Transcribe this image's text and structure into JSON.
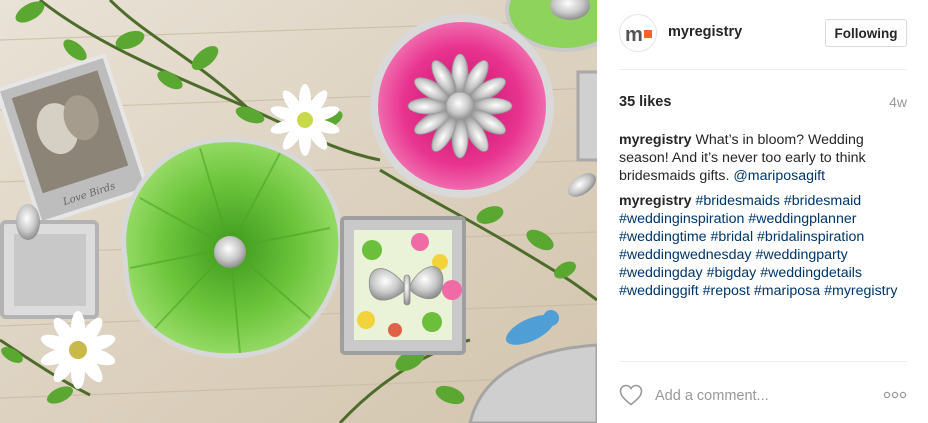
{
  "header": {
    "avatar_logo": "m",
    "username": "myregistry",
    "follow_label": "Following"
  },
  "stats": {
    "likes": "35 likes",
    "age": "4w"
  },
  "caption": {
    "author": "myregistry",
    "text": "What’s in bloom? Wedding season! And it’s never too early to think bridesmaids gifts.",
    "mention": "@mariposagift"
  },
  "hashtags_comment": {
    "author": "myregistry",
    "tags": [
      "#bridesmaids",
      "#bridesmaid",
      "#weddinginspiration",
      "#weddingplanner",
      "#weddingtime",
      "#bridal",
      "#bridalinspiration",
      "#weddingwednesday",
      "#weddingparty",
      "#weddingday",
      "#bigday",
      "#weddingdetails",
      "#weddinggift",
      "#repost",
      "#mariposa",
      "#myregistry"
    ]
  },
  "comment_box": {
    "placeholder": "Add a comment..."
  },
  "icons": {
    "like": "heart-outline-icon",
    "more": "more-options-icon"
  },
  "colors": {
    "link": "#003569",
    "muted": "#999999",
    "text": "#262626",
    "logo_accent": "#f26522"
  }
}
